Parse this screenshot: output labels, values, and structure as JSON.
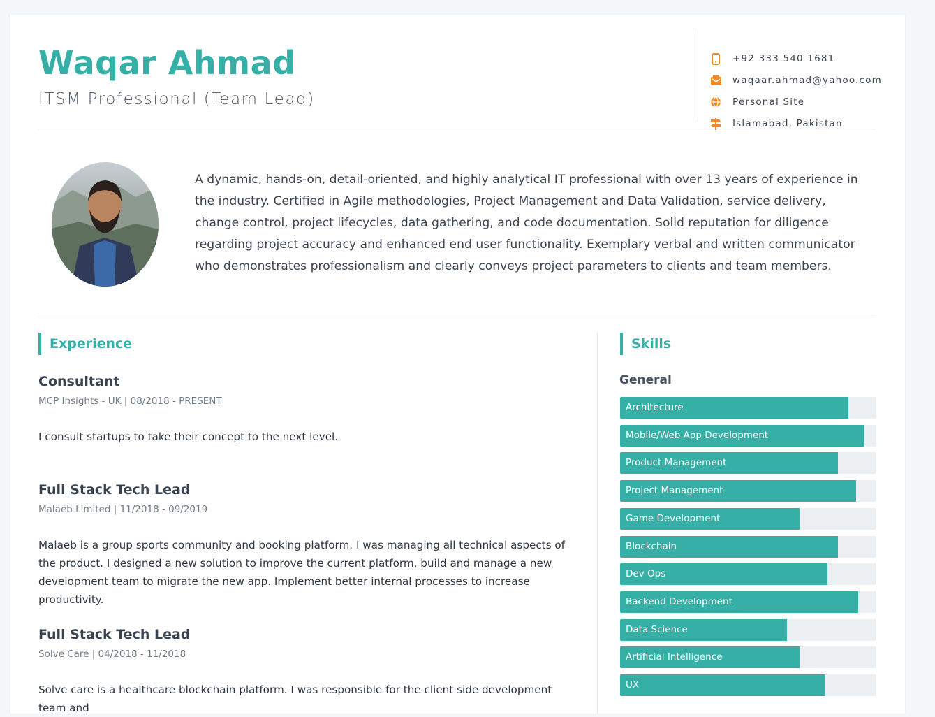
{
  "header": {
    "name": "Waqar Ahmad",
    "role": "ITSM Professional (Team Lead)"
  },
  "contact": [
    {
      "icon": "phone-icon",
      "text": "+92 333 540 1681"
    },
    {
      "icon": "email-icon",
      "text": "waqaar.ahmad@yahoo.com"
    },
    {
      "icon": "globe-icon",
      "text": "Personal Site"
    },
    {
      "icon": "signpost-icon",
      "text": "Islamabad, Pakistan"
    }
  ],
  "summary": "A dynamic, hands-on, detail-oriented, and highly analytical IT professional with over 13 years of experience in the industry. Certified in Agile methodologies, Project Management and Data Validation, service delivery, change control, project lifecycles, data gathering, and code documentation. Solid reputation for diligence regarding project accuracy and enhanced end user functionality. Exemplary verbal and written communicator who demonstrates professionalism and clearly conveys project parameters to clients and team members.",
  "experience": {
    "title": "Experience",
    "jobs": [
      {
        "title": "Consultant",
        "meta": "MCP Insights - UK | 08/2018 - PRESENT",
        "desc": "I consult startups to take their concept to the next level."
      },
      {
        "title": "Full Stack Tech Lead",
        "meta": "Malaeb Limited | 11/2018 - 09/2019",
        "desc": "Malaeb is a group sports community and booking platform. I was managing all technical aspects of the product. I designed a new solution to improve the current platform, build and manage a new development team to migrate the new app. Implement better internal processes to increase productivity."
      },
      {
        "title": "Full Stack Tech Lead",
        "meta": "Solve Care | 04/2018 - 11/2018",
        "desc": "Solve care is a healthcare blockchain platform. I was responsible for the client side development team and"
      }
    ]
  },
  "skills": {
    "title": "Skills",
    "group": "General",
    "items": [
      {
        "label": "Architecture",
        "level": 0.89
      },
      {
        "label": "Mobile/Web App Development",
        "level": 0.95
      },
      {
        "label": "Product Management",
        "level": 0.85
      },
      {
        "label": "Project Management",
        "level": 0.92
      },
      {
        "label": "Game Development",
        "level": 0.7
      },
      {
        "label": "Blockchain",
        "level": 0.85
      },
      {
        "label": "Dev Ops",
        "level": 0.81
      },
      {
        "label": "Backend Development",
        "level": 0.93
      },
      {
        "label": "Data Science",
        "level": 0.65
      },
      {
        "label": "Artificial Intelligence",
        "level": 0.7
      },
      {
        "label": "UX",
        "level": 0.8
      }
    ]
  },
  "colors": {
    "accent": "#36b0a7",
    "icon": "#f0892a"
  }
}
